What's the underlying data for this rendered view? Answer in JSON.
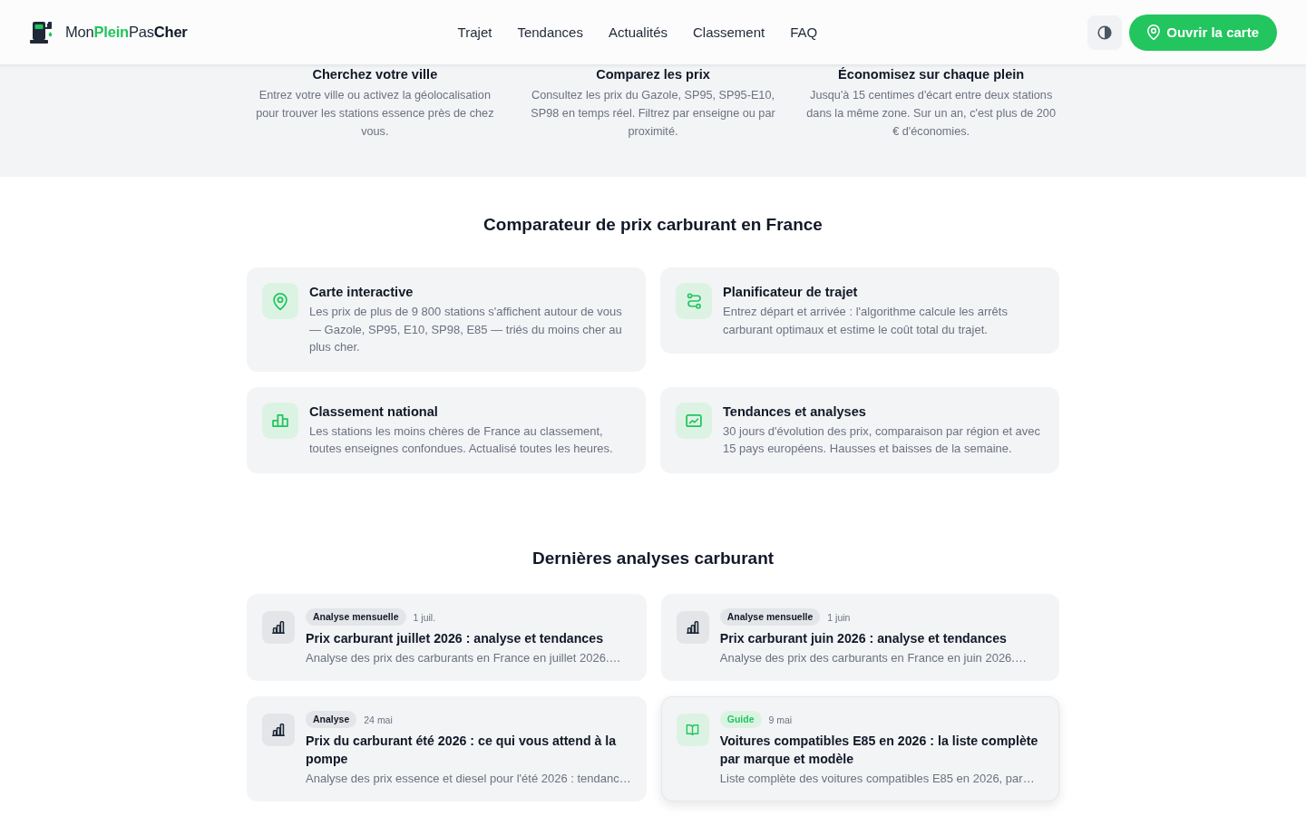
{
  "header": {
    "brand": [
      {
        "text": "Mon",
        "kind": "plain"
      },
      {
        "text": "Plein",
        "kind": "accent"
      },
      {
        "text": "Pas",
        "kind": "plain"
      },
      {
        "text": "Cher",
        "kind": "strong"
      }
    ],
    "nav": [
      "Trajet",
      "Tendances",
      "Actualités",
      "Classement",
      "FAQ"
    ],
    "cta": "Ouvrir la carte"
  },
  "steps": [
    {
      "title": "Cherchez votre ville",
      "text": "Entrez votre ville ou activez la géolocalisation pour trouver les stations essence près de chez vous."
    },
    {
      "title": "Comparez les prix",
      "text": "Consultez les prix du Gazole, SP95, SP95-E10, SP98 en temps réel. Filtrez par enseigne ou par proximité."
    },
    {
      "title": "Économisez sur chaque plein",
      "text": "Jusqu'à 15 centimes d'écart entre deux stations dans la même zone. Sur un an, c'est plus de 200 € d'économies."
    }
  ],
  "features": {
    "title": "Comparateur de prix carburant en France",
    "items": [
      {
        "kind": "map",
        "title": "Carte interactive",
        "text": "Les prix de plus de 9 800 stations s'affichent autour de vous — Gazole, SP95, E10, SP98, E85 — triés du moins cher au plus cher."
      },
      {
        "kind": "route",
        "title": "Planificateur de trajet",
        "text": "Entrez départ et arrivée : l'algorithme calcule les arrêts carburant optimaux et estime le coût total du trajet."
      },
      {
        "kind": "ranking",
        "title": "Classement national",
        "text": "Les stations les moins chères de France au classement, toutes enseignes confondues. Actualisé toutes les heures."
      },
      {
        "kind": "trends",
        "title": "Tendances et analyses",
        "text": "30 jours d'évolution des prix, comparaison par région et avec 15 pays européens. Hausses et baisses de la semaine."
      }
    ]
  },
  "articles": {
    "title": "Dernières analyses carburant",
    "items": [
      {
        "kind": "analysis",
        "category": "Analyse mensuelle",
        "date": "1 juil.",
        "title": "Prix carburant juillet 2026 : analyse et tendances",
        "excerpt": "Analyse des prix des carburants en France en juillet 2026.…",
        "highlighted": false
      },
      {
        "kind": "analysis",
        "category": "Analyse mensuelle",
        "date": "1 juin",
        "title": "Prix carburant juin 2026 : analyse et tendances",
        "excerpt": "Analyse des prix des carburants en France en juin 2026.…",
        "highlighted": false
      },
      {
        "kind": "analysis",
        "category": "Analyse",
        "date": "24 mai",
        "title": "Prix du carburant été 2026 : ce qui vous attend à la pompe",
        "excerpt": "Analyse des prix essence et diesel pour l'été 2026 : tendanc…",
        "highlighted": false
      },
      {
        "kind": "guide",
        "category": "Guide",
        "date": "9 mai",
        "title": "Voitures compatibles E85 en 2026 : la liste complète par marque et modèle",
        "excerpt": "Liste complète des voitures compatibles E85 en 2026, par…",
        "highlighted": true
      }
    ]
  }
}
